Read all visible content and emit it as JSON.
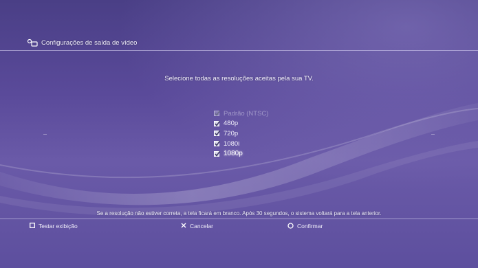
{
  "header": {
    "title": "Configurações de saída de vídeo",
    "icon": "display-settings-icon"
  },
  "prompt": "Selecione todas as resoluções aceitas pela sua TV.",
  "resolutions": [
    {
      "label": "Padrão (NTSC)",
      "checked": true,
      "disabled": true
    },
    {
      "label": "480p",
      "checked": true,
      "disabled": false
    },
    {
      "label": "720p",
      "checked": true,
      "disabled": false
    },
    {
      "label": "1080i",
      "checked": true,
      "disabled": false
    },
    {
      "label": "1080p",
      "checked": true,
      "disabled": false,
      "focused": true
    }
  ],
  "note": "Se a resolução não estiver correta, a tela ficará em branco. Após 30 segundos, o sistema voltará para a tela anterior.",
  "footer": {
    "test": {
      "label": "Testar exibição",
      "icon": "square-button-icon"
    },
    "cancel": {
      "label": "Cancelar",
      "icon": "cross-button-icon"
    },
    "confirm": {
      "label": "Confirmar",
      "icon": "circle-button-icon"
    }
  }
}
